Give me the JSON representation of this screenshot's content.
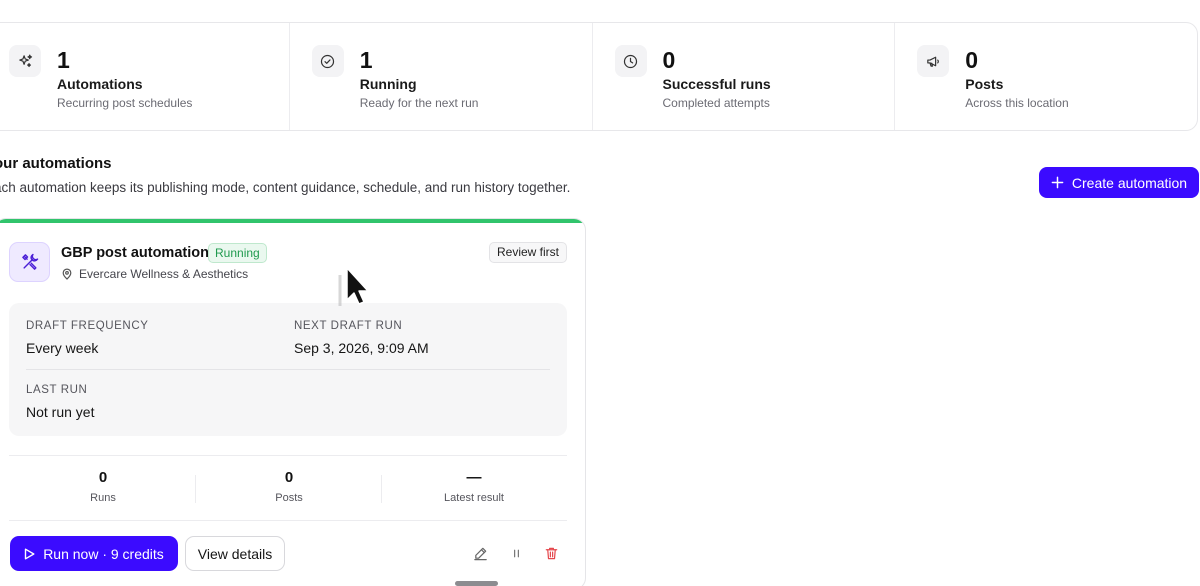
{
  "stats": [
    {
      "icon": "sparkles-icon",
      "value": "1",
      "label": "Automations",
      "sub": "Recurring post schedules"
    },
    {
      "icon": "check-circle-icon",
      "value": "1",
      "label": "Running",
      "sub": "Ready for the next run"
    },
    {
      "icon": "clock-icon",
      "value": "0",
      "label": "Successful runs",
      "sub": "Completed attempts"
    },
    {
      "icon": "megaphone-icon",
      "value": "0",
      "label": "Posts",
      "sub": "Across this location"
    }
  ],
  "section": {
    "title": "our automations",
    "subtitle": "ach automation keeps its publishing mode, content guidance, schedule, and run history together.",
    "create_label": "Create automation"
  },
  "card": {
    "title": "GBP post automation",
    "status": "Running",
    "location": "Evercare Wellness & Aesthetics",
    "mode": "Review first",
    "details": {
      "draft_frequency_label": "DRAFT FREQUENCY",
      "draft_frequency_value": "Every week",
      "next_run_label": "NEXT DRAFT RUN",
      "next_run_value": "Sep 3, 2026, 9:09 AM",
      "last_run_label": "LAST RUN",
      "last_run_value": "Not run yet"
    },
    "counts": [
      {
        "value": "0",
        "label": "Runs"
      },
      {
        "value": "0",
        "label": "Posts"
      },
      {
        "value": "—",
        "label": "Latest result"
      }
    ],
    "run_label": "Run now · 9 credits",
    "details_label": "View details"
  },
  "colors": {
    "accent": "#3b0bff",
    "success": "#31c46c",
    "danger": "#e5484d"
  }
}
